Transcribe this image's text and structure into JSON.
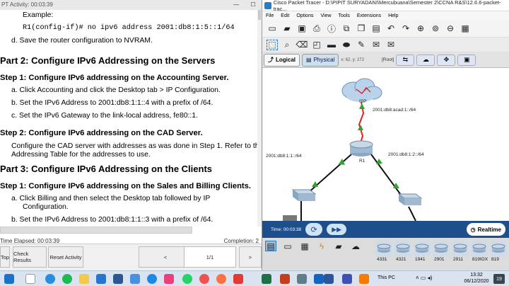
{
  "left_window": {
    "title": "PT Activity: 00:03:39",
    "document_lines": [
      {
        "text": "Example:",
        "style": "bd",
        "indent": 32
      },
      {
        "text": "R1(config-if)# no ipv6 address 2001:db8:1:5::1/64",
        "style": "mono",
        "indent": 32
      },
      {
        "text": "d.   Save the router configuration to NVRAM.",
        "style": "bd",
        "indent": 16
      },
      {
        "text": "Part 2: Configure IPv6 Addressing on the Servers",
        "style": "h1",
        "indent": 0
      },
      {
        "text": "Step 1: Configure IPv6 addressing on the Accounting Server.",
        "style": "h2",
        "indent": 0
      },
      {
        "text": "a.   Click Accounting and click the Desktop tab > IP Configuration.",
        "style": "bd",
        "indent": 16
      },
      {
        "text": "b.   Set the IPv6 Address to 2001:db8:1:1::4 with a prefix of /64.",
        "style": "bd",
        "indent": 16
      },
      {
        "text": "c.   Set the IPv6 Gateway to the link-local address, fe80::1.",
        "style": "bd",
        "indent": 16
      },
      {
        "text": "Step 2: Configure IPv6 addressing on the CAD Server.",
        "style": "h2",
        "indent": 0
      },
      {
        "text": "Configure the CAD server with addresses as was done in Step 1. Refer to the",
        "style": "bd",
        "indent": 16
      },
      {
        "text": "Addressing Table for the addresses to use.",
        "style": "bd",
        "indent": 16
      },
      {
        "text": "Part 3: Configure IPv6 Addressing on the Clients",
        "style": "h1",
        "indent": 0
      },
      {
        "text": "Step 1: Configure IPv6 addressing on the Sales and Billing Clients.",
        "style": "h2",
        "indent": 0
      },
      {
        "text": "a.   Click Billing and then select the Desktop tab followed by IP",
        "style": "bd",
        "indent": 16
      },
      {
        "text": "Configuration.",
        "style": "bd",
        "indent": 32
      },
      {
        "text": "b.   Set the IPv6 Address to 2001:db8:1:1::3 with a prefix of /64.",
        "style": "bd",
        "indent": 16
      }
    ],
    "elapsed": "Time Elapsed: 00:03:39",
    "completion": "Completion: 2",
    "buttons": [
      "Top",
      "Check Results",
      "Reset Activity",
      "<",
      "1/1",
      ">"
    ]
  },
  "packet_tracer": {
    "title": "Cisco Packet Tracer - D:\\PIPIT SURYADANI\\Mercubuana\\Semester 2\\CCNA R&S\\12.6.6-packet-trac...",
    "menu": [
      "File",
      "Edit",
      "Options",
      "View",
      "Tools",
      "Extensions",
      "Help"
    ],
    "tabs": {
      "logical": "Logical",
      "physical": "Physical",
      "coords": "x: 62, y: 272",
      "root": "[Root]"
    },
    "labels": {
      "isp": "ISP",
      "isp_link": "2001:db8:acad:1::/64",
      "r1": "R1",
      "left_net": "2001:db8:1:1::/64",
      "right_net": "2001:db8:1:2::/64"
    },
    "time": "Time: 00:03:38",
    "realtime": "Realtime",
    "devices": [
      "4331",
      "4321",
      "1941",
      "2901",
      "2911",
      "819IOX",
      "819"
    ]
  },
  "taskbar": {
    "tray": "This PC",
    "time": "13:32",
    "date": "06/12/2020",
    "notifications": "19"
  }
}
